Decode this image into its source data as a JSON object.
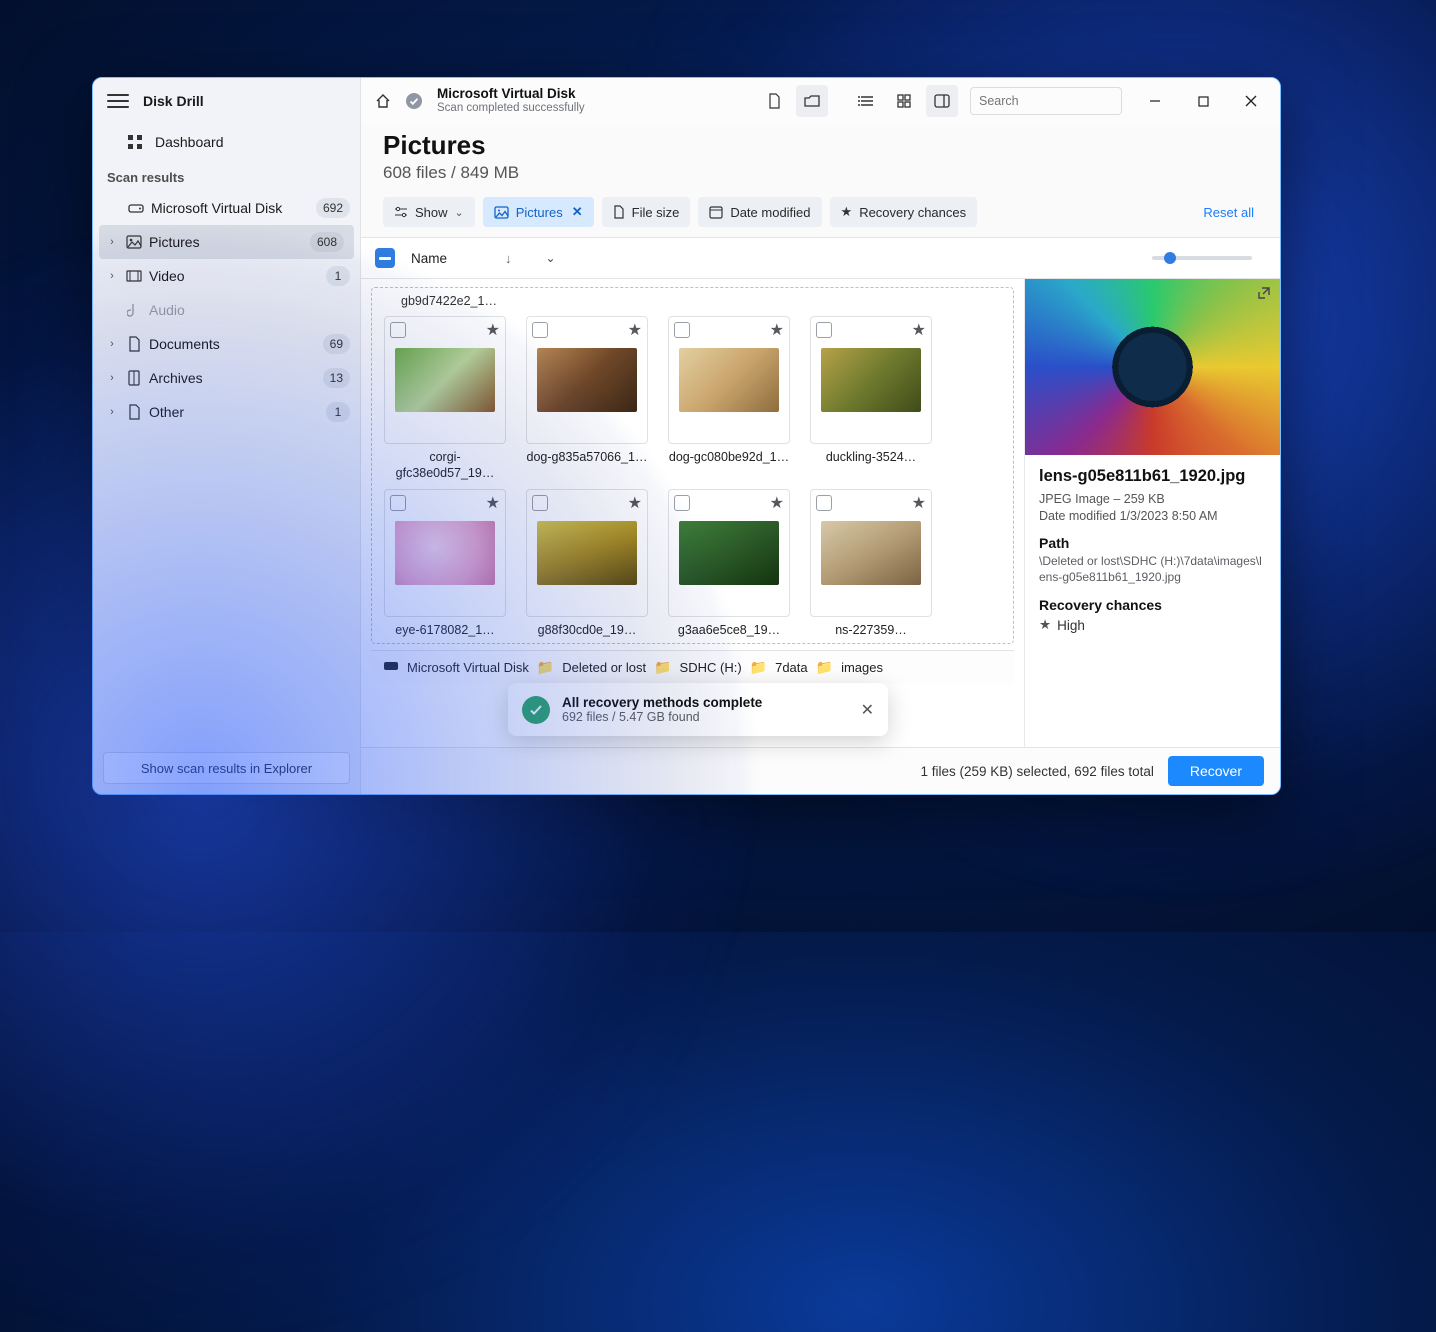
{
  "app": {
    "name": "Disk Drill"
  },
  "sidebar": {
    "dashboard": "Dashboard",
    "section": "Scan results",
    "items": [
      {
        "label": "Microsoft Virtual Disk",
        "badge": "692"
      },
      {
        "label": "Pictures",
        "badge": "608"
      },
      {
        "label": "Video",
        "badge": "1"
      },
      {
        "label": "Audio",
        "badge": ""
      },
      {
        "label": "Documents",
        "badge": "69"
      },
      {
        "label": "Archives",
        "badge": "13"
      },
      {
        "label": "Other",
        "badge": "1"
      }
    ],
    "footer_button": "Show scan results in Explorer"
  },
  "titlebar": {
    "title": "Microsoft Virtual Disk",
    "subtitle": "Scan completed successfully",
    "search_placeholder": "Search"
  },
  "page": {
    "title": "Pictures",
    "subtitle": "608 files / 849 MB"
  },
  "filters": {
    "show": "Show",
    "pictures": "Pictures",
    "filesize": "File size",
    "datemod": "Date modified",
    "recovery": "Recovery chances",
    "reset": "Reset all"
  },
  "listhead": {
    "name": "Name"
  },
  "fragments": [
    "gb9d7422e2_1…"
  ],
  "thumbs": [
    {
      "cap": "corgi-gfc38e0d57_19…"
    },
    {
      "cap": "dog-g835a57066_1…"
    },
    {
      "cap": "dog-gc080be92d_1…"
    },
    {
      "cap": "duckling-3524…"
    },
    {
      "cap": "eye-6178082_1…"
    },
    {
      "cap": "g88f30cd0e_19…"
    },
    {
      "cap": "g3aa6e5ce8_19…"
    },
    {
      "cap": "ns-227359…"
    }
  ],
  "breadcrumb": [
    "Microsoft Virtual Disk",
    "Deleted or lost",
    "SDHC (H:)",
    "7data",
    "images"
  ],
  "preview": {
    "filename": "lens-g05e811b61_1920.jpg",
    "type_size": "JPEG Image – 259 KB",
    "modified": "Date modified 1/3/2023 8:50 AM",
    "path_label": "Path",
    "path": "\\Deleted or lost\\SDHC (H:)\\7data\\images\\lens-g05e811b61_1920.jpg",
    "rc_label": "Recovery chances",
    "rc_value": "High"
  },
  "footer": {
    "status": "1 files (259 KB) selected, 692 files total",
    "recover": "Recover"
  },
  "toast": {
    "title": "All recovery methods complete",
    "detail": "692 files / 5.47 GB found"
  }
}
